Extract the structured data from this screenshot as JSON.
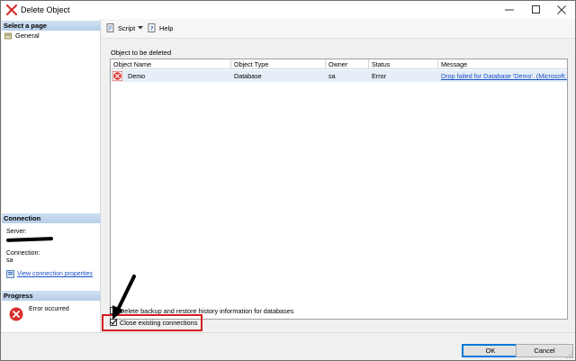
{
  "window": {
    "title": "Delete Object"
  },
  "sidebar": {
    "select_page_header": "Select a page",
    "pages": [
      {
        "label": "General"
      }
    ],
    "connection_header": "Connection",
    "server_label": "Server:",
    "connection_label": "Connection:",
    "connection_value": "sa",
    "view_connection_link": "View connection properties",
    "progress_header": "Progress",
    "progress_status": "Error occurred"
  },
  "toolbar": {
    "script_label": "Script",
    "help_label": "Help"
  },
  "main": {
    "group_label": "Object to be deleted",
    "columns": [
      "Object Name",
      "Object Type",
      "Owner",
      "Status",
      "Message"
    ],
    "rows": [
      {
        "name": "Demo",
        "type": "Database",
        "owner": "sa",
        "status": "Error",
        "message": "Drop failed for Database 'Demo'. (Microsoft..."
      }
    ],
    "option_delete_backup": "Delete backup and restore history information for databases",
    "option_close_connections": "Close existing connections"
  },
  "footer": {
    "ok_label": "OK",
    "cancel_label": "Cancel"
  },
  "colors": {
    "accent": "#0078d7",
    "highlight": "#d62020",
    "error": "#d9302c",
    "link": "#1a4fc9"
  }
}
